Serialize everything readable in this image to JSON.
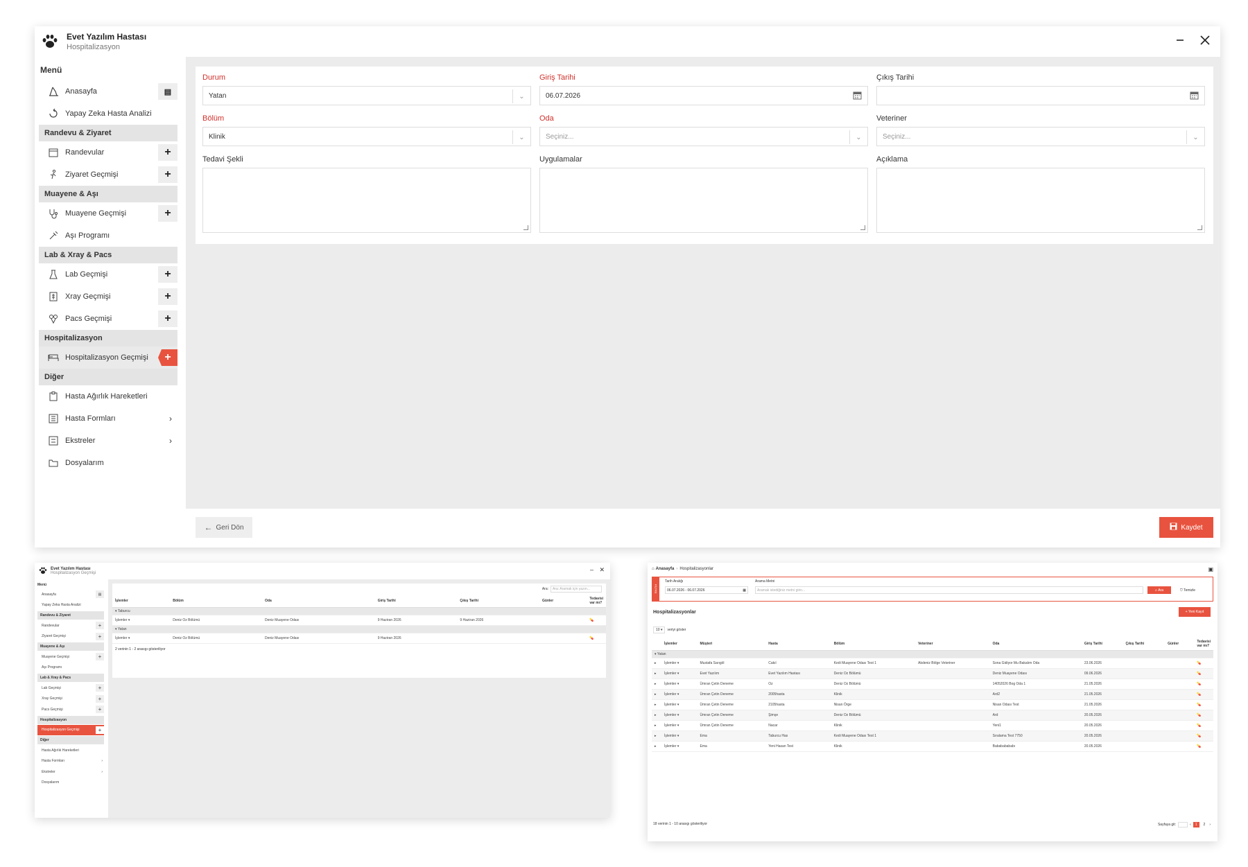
{
  "app": {
    "title": "Evet Yazılım Hastası",
    "subtitle": "Hospitalizasyon"
  },
  "sidebar": {
    "menu_title": "Menü",
    "items": [
      {
        "label": "Anasayfa"
      },
      {
        "label": "Yapay Zeka Hasta Analizi"
      },
      {
        "label": "Randevu & Ziyaret"
      },
      {
        "label": "Randevular"
      },
      {
        "label": "Ziyaret Geçmişi"
      },
      {
        "label": "Muayene & Aşı"
      },
      {
        "label": "Muayene Geçmişi"
      },
      {
        "label": "Aşı Programı"
      },
      {
        "label": "Lab & Xray & Pacs"
      },
      {
        "label": "Lab Geçmişi"
      },
      {
        "label": "Xray Geçmişi"
      },
      {
        "label": "Pacs Geçmişi"
      },
      {
        "label": "Hospitalizasyon"
      },
      {
        "label": "Hospitalizasyon Geçmişi"
      },
      {
        "label": "Diğer"
      },
      {
        "label": "Hasta Ağırlık Hareketleri"
      },
      {
        "label": "Hasta Formları"
      },
      {
        "label": "Ekstreler"
      },
      {
        "label": "Dosyalarım"
      }
    ]
  },
  "form": {
    "durum": {
      "label": "Durum",
      "value": "Yatan"
    },
    "giris": {
      "label": "Giriş Tarihi",
      "value": "06.07.2026"
    },
    "cikis": {
      "label": "Çıkış Tarihi",
      "value": ""
    },
    "bolum": {
      "label": "Bölüm",
      "value": "Klinik"
    },
    "oda": {
      "label": "Oda",
      "placeholder": "Seçiniz..."
    },
    "veteriner": {
      "label": "Veteriner",
      "placeholder": "Seçiniz..."
    },
    "tedavi": {
      "label": "Tedavi Şekli"
    },
    "uygulamalar": {
      "label": "Uygulamalar"
    },
    "aciklama": {
      "label": "Açıklama"
    }
  },
  "footer": {
    "back": "Geri Dön",
    "save": "Kaydet"
  },
  "win2": {
    "title": "Evet Yazılım Hastası",
    "subtitle": "Hospitalizasyon Geçmişi",
    "search_label": "Ara:",
    "search_placeholder": "Ara: Aramak için yazın...",
    "headers": [
      "İşlemler",
      "Bölüm",
      "Oda",
      "Giriş Tarihi",
      "Çıkış Tarihi",
      "Günler",
      "Tedavisi var mı?"
    ],
    "groups": [
      {
        "name": "Taburcu",
        "rows": [
          [
            "İşlemler ▾",
            "Deniz Oz Bölümü",
            "Deniz Muayene Odası",
            "9 Haziran 2026",
            "9 Haziran 2026",
            "",
            ""
          ]
        ]
      },
      {
        "name": "Yatan",
        "rows": [
          [
            "İşlemler ▾",
            "Deniz Oz Bölümü",
            "Deniz Muayene Odası",
            "9 Haziran 2026",
            "",
            "",
            ""
          ]
        ]
      }
    ],
    "info": "2 verinin 1 - 2 arasıgı gösteriliyor"
  },
  "win3": {
    "breadcrumb_home": "Anasayfa",
    "breadcrumb_current": "Hospitalizasyonlar",
    "filter_tag": "FİLTRE",
    "date_label": "Tarih Aralığı",
    "date_value": "06.07.2026 - 06.07.2026",
    "search_label": "Arama Metni",
    "search_placeholder": "Aramak istediğiniz metni girin...",
    "btn_search": "Ara",
    "btn_clear": "Temizle",
    "list_title": "Hospitalizasyonlar",
    "btn_new": "Yeni Kayıt",
    "page_size": "10",
    "page_size_label": "veriyi göster",
    "headers": [
      "İşlemler",
      "Müşteri",
      "Hasta",
      "Bölüm",
      "Veteriner",
      "Oda",
      "Giriş Tarihi",
      "Çıkış Tarihi",
      "Günler",
      "Tedavisi var mı?"
    ],
    "group": "Yatan",
    "rows": [
      [
        "İşlemler ▾",
        "Mustafa Sarıgöl",
        "Cakıl",
        "Kedi Muayene Odası Test 1",
        "Akdeniz Bölge Veteriner",
        "Sona Gidiyor Mu Bakalım Oda",
        "23.06.2026"
      ],
      [
        "İşlemler ▾",
        "Evet Yazılım",
        "Evet Yazılım Hastası",
        "Deniz Oz Bölümü",
        "",
        "Deniz Muayene Odası",
        "09.06.2026"
      ],
      [
        "İşlemler ▾",
        "Ümran Çetin Deneme",
        "Oz",
        "Deniz Oz Bölümü",
        "",
        "14052026 Bog Oda 1",
        "21.05.2026"
      ],
      [
        "İşlemler ▾",
        "Ümran Çetin Deneme",
        "2005hasta",
        "Klinik",
        "",
        "Ard2",
        "21.05.2026"
      ],
      [
        "İşlemler ▾",
        "Ümran Çetin Deneme",
        "2105hasta",
        "Nisan Örge",
        "",
        "Nisan Odası Test",
        "21.05.2026"
      ],
      [
        "İşlemler ▾",
        "Ümran Çetin Deneme",
        "Şimşe",
        "Deniz Oz Bölümü",
        "",
        "Ard",
        "20.05.2026"
      ],
      [
        "İşlemler ▾",
        "Ümran Çetin Deneme",
        "Nacar",
        "Klinik",
        "",
        "Yeni1",
        "20.05.2026"
      ],
      [
        "İşlemler ▾",
        "Ema",
        "Taburcu Has",
        "Kedi Muayene Odası Test 1",
        "",
        "Sıralama Test 7750",
        "20.05.2026"
      ],
      [
        "İşlemler ▾",
        "Ema",
        "Yeni Hasan Test",
        "Klinik",
        "",
        "Babababababı",
        "20.05.2026"
      ]
    ],
    "info": "18 verinin 1 - 10 arasıgı gösteriliyor",
    "page_label": "Sayfaya git:",
    "pages": [
      "1",
      "2"
    ]
  },
  "colors": {
    "accent": "#e8533f",
    "required": "#d0302a"
  }
}
